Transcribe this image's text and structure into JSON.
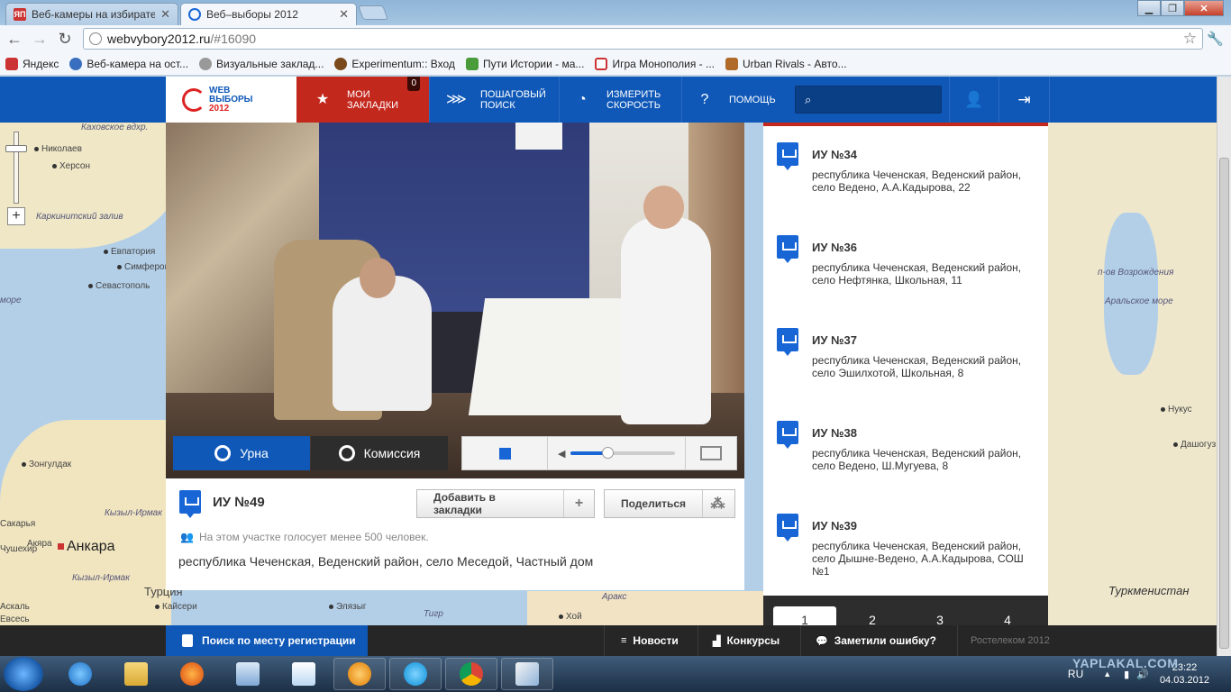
{
  "browser": {
    "tabs": [
      {
        "favicon_text": "ЯП",
        "title": "Веб-камеры на избирател",
        "active": false
      },
      {
        "title": "Веб–выборы 2012",
        "active": true
      }
    ],
    "url_host": "webvybory2012.ru",
    "url_path": "/#16090",
    "bookmarks": [
      "Яндекс",
      "Веб-камера на ост...",
      "Визуальные заклад...",
      "Experimentum:: Вход",
      "Пути Истории - ма...",
      "Игра Монополия - ...",
      "Urban Rivals - Авто..."
    ],
    "window_buttons": {
      "minimize": "▁",
      "maximize": "❐",
      "close": "✕"
    }
  },
  "site": {
    "logo": {
      "line1": "WEB",
      "line2": "ВЫБОРЫ",
      "line3": "2012"
    },
    "nav": {
      "bookmarks_label": "МОИ ЗАКЛАДКИ",
      "bookmarks_count": "0",
      "stepsearch_label": "ПОШАГОВЫЙ ПОИСК",
      "speed_label": "ИЗМЕРИТЬ СКОРОСТЬ",
      "help_label": "ПОМОЩЬ"
    },
    "search": {
      "placeholder": "",
      "value": ""
    }
  },
  "map": {
    "labels": [
      "Каховское вдхр.",
      "Николаев",
      "Херсон",
      "Каркинитский залив",
      "Евпатория",
      "Симферополь",
      "Севастополь",
      "море",
      "Зонгулдак",
      "Кызыл-Ирмак",
      "Анкара",
      "Турция",
      "Кайсери",
      "Элязыг",
      "Хой",
      "п-ов Возрождения",
      "Аральское море",
      "Нукус",
      "Дашогуз",
      "Туркменистан",
      "Акяра",
      "Кызыл-Ирмак",
      "Сакарья",
      "Чушехир",
      "Аскаль",
      "Евсесь",
      "Аракс",
      "Тигр"
    ]
  },
  "video": {
    "buttons": {
      "urna": "Урна",
      "komissia": "Комиссия"
    },
    "volume_level": 0.35
  },
  "card": {
    "title": "ИУ №49",
    "add_bookmark": "Добавить в закладки",
    "add_icon": "+",
    "share": "Поделиться",
    "share_icon": "⁂",
    "voters_note": "На этом участке голосует менее 500 человек.",
    "address": "республика Чеченская, Веденский район, село Меседой, Частный дом"
  },
  "list": {
    "items": [
      {
        "title": "ИУ №34",
        "address": "республика Чеченская, Веденский район, село Ведено, А.А.Кадырова, 22"
      },
      {
        "title": "ИУ №36",
        "address": "республика Чеченская, Веденский район, село Нефтянка, Школьная, 11"
      },
      {
        "title": "ИУ №37",
        "address": "республика Чеченская, Веденский район, село Эшилхотой, Школьная, 8"
      },
      {
        "title": "ИУ №38",
        "address": "республика Чеченская, Веденский район, село Ведено, Ш.Мугуева, 8"
      },
      {
        "title": "ИУ №39",
        "address": "республика Чеченская, Веденский район, село Дышне-Ведено, А.А.Кадырова, СОШ №1"
      }
    ],
    "pages": [
      "1",
      "2",
      "3",
      "4"
    ],
    "active_page": "1"
  },
  "footer": {
    "search_registration": "Поиск по месту регистрации",
    "news": "Новости",
    "contests": "Конкурсы",
    "report_error": "Заметили ошибку?",
    "copyright": "Ростелеком 2012"
  },
  "taskbar": {
    "lang": "RU",
    "time": "23:22",
    "date": "04.03.2012",
    "watermark": "YAPLAKAL.COM"
  }
}
